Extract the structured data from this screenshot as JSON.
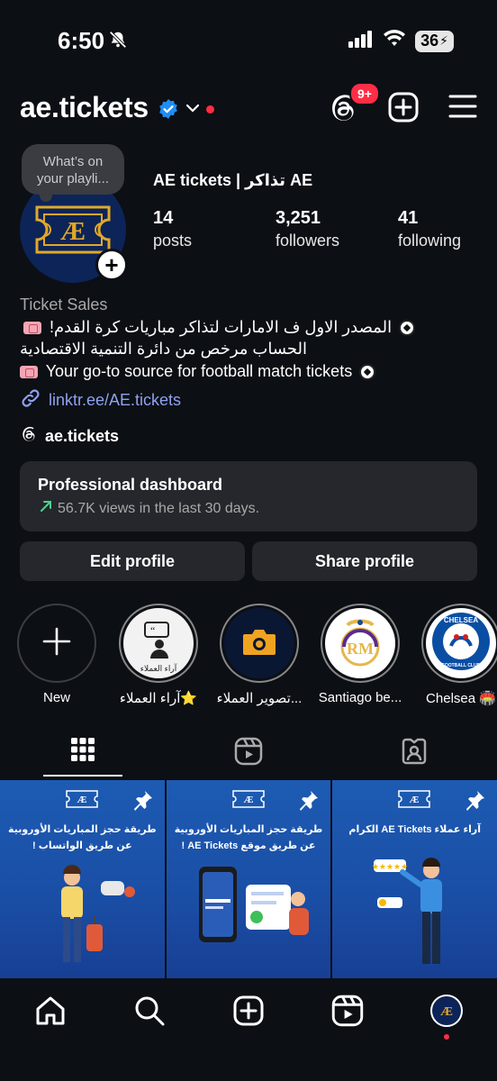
{
  "status_bar": {
    "time": "6:50",
    "battery": "36"
  },
  "header": {
    "username": "ae.tickets",
    "notification_count": "9+"
  },
  "profile": {
    "note": "What’s on your playli...",
    "display_name": "AE tickets | تذاكر AE",
    "stats": [
      {
        "value": "14",
        "label": "posts"
      },
      {
        "value": "3,251",
        "label": "followers"
      },
      {
        "value": "41",
        "label": "following"
      }
    ],
    "category": "Ticket Sales",
    "bio_line1": "المصدر الاول ف الامارات لتذاكر مباريات كرة القدم!",
    "bio_line2": "الحساب مرخص من دائرة التنمية الاقتصادية",
    "bio_line3": "Your go-to source for football match tickets",
    "link": "linktr.ee/AE.tickets",
    "threads_handle": "ae.tickets"
  },
  "dashboard": {
    "title": "Professional dashboard",
    "subtitle": "56.7K views in the last 30 days."
  },
  "buttons": {
    "edit": "Edit profile",
    "share": "Share profile"
  },
  "highlights": [
    {
      "label": "New"
    },
    {
      "label": "آراء العملاء⭐️"
    },
    {
      "label": "تصوير العملاء..."
    },
    {
      "label": "Santiago be..."
    },
    {
      "label": "Chelsea 🏟️"
    }
  ],
  "highlight_text": {
    "reviews": "آراء العملاء",
    "chelsea": "CHELSEA",
    "chelsea_sub": "FOOTBALL CLUB"
  },
  "posts": [
    {
      "line1": "طريقة حجز المباريات الأوروبية",
      "line2": "عن طريق الواتساب !"
    },
    {
      "line1": "طريقة حجز المباريات الأوروبية",
      "line2": "عن طريق موقع AE Tickets !"
    },
    {
      "line1": "آراء عملاء AE Tickets الكرام",
      "line2": ""
    }
  ],
  "colors": {
    "background": "#0c0f14",
    "card": "#25272c",
    "link": "#8ea2f0",
    "accent_red": "#ff2d45",
    "verified": "#1f8df5"
  }
}
